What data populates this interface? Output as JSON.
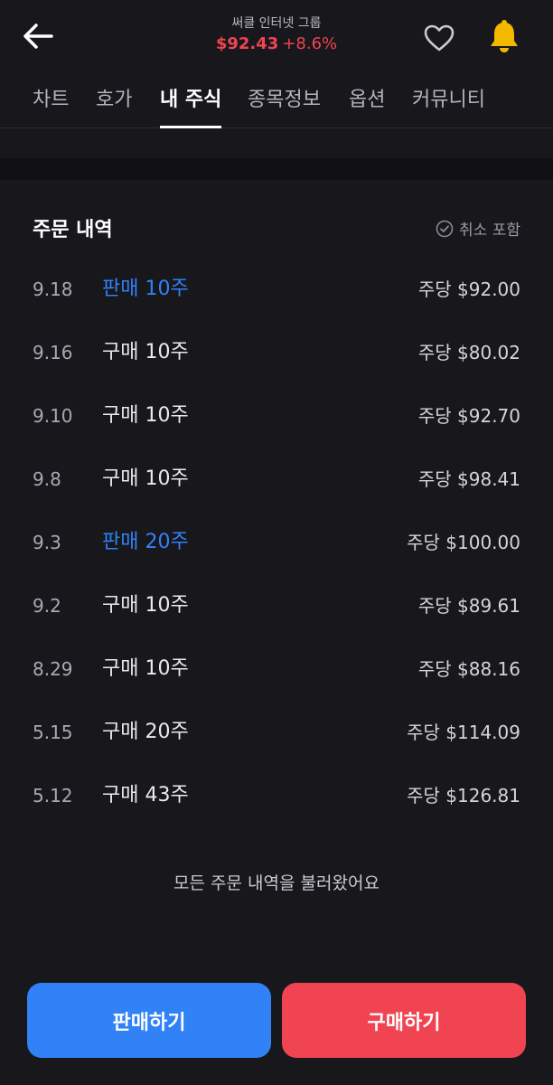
{
  "header": {
    "stock_name": "써클 인터넷 그룹",
    "price": "$92.43",
    "change": "+8.6%",
    "icons": {
      "back": "arrow-left-icon",
      "favorite": "heart-icon",
      "alert": "bell-icon"
    },
    "colors": {
      "price_down_up": "#f04452",
      "bell": "#f5b800"
    }
  },
  "tabs": [
    {
      "label": "차트"
    },
    {
      "label": "호가"
    },
    {
      "label": "내 주식",
      "active": true
    },
    {
      "label": "종목정보"
    },
    {
      "label": "옵션"
    },
    {
      "label": "커뮤니티"
    }
  ],
  "orders": {
    "title": "주문 내역",
    "include_cancel_label": "취소 포함",
    "items": [
      {
        "date": "9.18",
        "type": "판매 10주",
        "side": "sell",
        "price": "주당 $92.00"
      },
      {
        "date": "9.16",
        "type": "구매 10주",
        "side": "buy",
        "price": "주당 $80.02"
      },
      {
        "date": "9.10",
        "type": "구매 10주",
        "side": "buy",
        "price": "주당 $92.70"
      },
      {
        "date": "9.8",
        "type": "구매 10주",
        "side": "buy",
        "price": "주당 $98.41"
      },
      {
        "date": "9.3",
        "type": "판매 20주",
        "side": "sell",
        "price": "주당 $100.00"
      },
      {
        "date": "9.2",
        "type": "구매 10주",
        "side": "buy",
        "price": "주당 $89.61"
      },
      {
        "date": "8.29",
        "type": "구매 10주",
        "side": "buy",
        "price": "주당 $88.16"
      },
      {
        "date": "5.15",
        "type": "구매 20주",
        "side": "buy",
        "price": "주당 $114.09"
      },
      {
        "date": "5.12",
        "type": "구매 43주",
        "side": "buy",
        "price": "주당 $126.81"
      }
    ],
    "all_loaded_text": "모든 주문 내역을 불러왔어요"
  },
  "actions": {
    "sell_label": "판매하기",
    "buy_label": "구매하기",
    "colors": {
      "sell": "#3182f6",
      "buy": "#f04452"
    }
  }
}
